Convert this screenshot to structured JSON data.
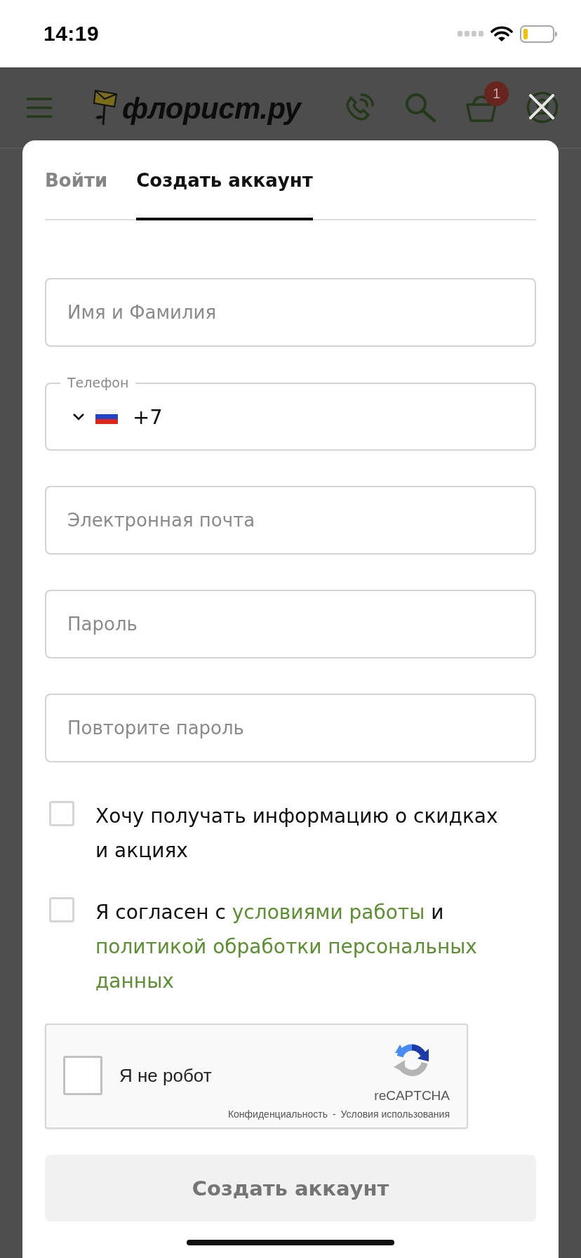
{
  "status_bar": {
    "time": "14:19"
  },
  "header": {
    "logo": "флорист.ру",
    "cart_badge": "1"
  },
  "modal": {
    "tabs": [
      {
        "label": "Войти",
        "selected": false
      },
      {
        "label": "Создать аккаунт",
        "selected": true
      }
    ],
    "fields": [
      {
        "kind": "text",
        "placeholder": "Имя и Фамилия"
      },
      {
        "kind": "phone",
        "label": "Телефон",
        "value": "+7"
      },
      {
        "kind": "text",
        "placeholder": "Электронная почта"
      },
      {
        "kind": "text",
        "placeholder": "Пароль"
      },
      {
        "kind": "text",
        "placeholder": "Повторите пароль"
      }
    ],
    "checkboxes": [
      {
        "checked": false,
        "parts": [
          {
            "kind": "text",
            "text": "Хочу получать информацию о скидках и акциях"
          }
        ]
      },
      {
        "checked": false,
        "parts": [
          {
            "kind": "text",
            "text": "Я согласен с"
          },
          {
            "kind": "link",
            "text": "условиями работы"
          },
          {
            "kind": "text",
            "text": "и"
          },
          {
            "kind": "link",
            "text": "политикой обработки персональных"
          },
          {
            "kind": "link",
            "text": "данных"
          }
        ]
      }
    ],
    "captcha": {
      "checked": false,
      "label": "Я не робот",
      "brand": "reCAPTCHA",
      "links": [
        {
          "kind": "link",
          "text": "Конфиденциальность"
        },
        {
          "kind": "separator",
          "text": "-"
        },
        {
          "kind": "link",
          "text": "Условия использования"
        }
      ]
    },
    "submit": {
      "label": "Создать аккаунт",
      "disabled": true
    }
  }
}
